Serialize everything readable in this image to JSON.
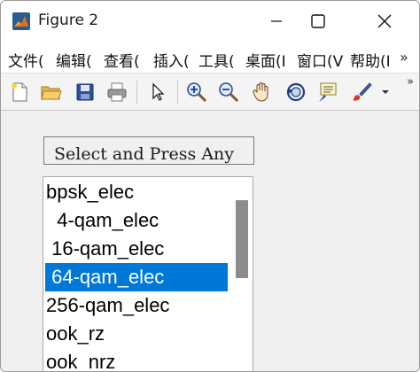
{
  "window": {
    "title": "Figure 2"
  },
  "menu": {
    "items": [
      "文件(",
      "编辑(",
      "查看(",
      "插入(",
      "工具(",
      "桌面(I",
      "窗口(V",
      "帮助(I"
    ],
    "more": "»"
  },
  "toolbar": {
    "buttons": [
      "new-file",
      "open-file",
      "save",
      "print",
      "edit-plot-pointer",
      "zoom-in",
      "zoom-out",
      "pan",
      "rotate-3d",
      "data-cursor",
      "brush",
      "brush-dropdown"
    ],
    "more": "»"
  },
  "prompt": {
    "text": "Select and Press Any Key"
  },
  "listbox": {
    "items": [
      "bpsk_elec",
      "  4-qam_elec",
      " 16-qam_elec",
      " 64-qam_elec",
      "256-qam_elec",
      "ook_rz",
      "ook_nrz"
    ],
    "selected_index": 3,
    "scroll_fraction": 0.1
  },
  "colors": {
    "selection": "#0078d7",
    "scroll_thumb": "#8c8c8c"
  }
}
